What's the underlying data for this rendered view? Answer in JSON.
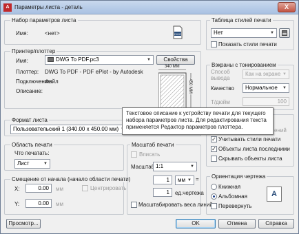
{
  "window": {
    "title": "Параметры листа - деталь",
    "app_icon": "autocad-icon",
    "close_glyph": "X"
  },
  "page_setup": {
    "group_label": "Набор параметров листа",
    "name_label": "Имя:",
    "name_value": "<нет>",
    "dwg_icon_text": "DWG"
  },
  "plotter": {
    "group_label": "Принтер/плоттер",
    "name_label": "Имя:",
    "device": "DWG To PDF.pc3",
    "properties_button": "Свойства",
    "plotter_label": "Плоттер:",
    "plotter_value": "DWG To PDF - PDF ePlot - by Autodesk",
    "connection_label": "Подключение:",
    "connection_value": "Файл",
    "description_label": "Описание:",
    "preview_width": "340 ММ",
    "preview_height": "450 ММ"
  },
  "tooltip": {
    "text": "Текстовое описание к устройству печати для текущего набора параметров листа. Для редактирования текста применяется Редактор параметров плоттера."
  },
  "paper_size": {
    "group_label": "Формат листа",
    "value": "Пользовательский 1 (340.00 x 450.00 мм)"
  },
  "plot_area": {
    "group_label": "Область печати",
    "what_label": "Что печатать:",
    "what_value": "Лист"
  },
  "plot_offset": {
    "group_label": "Смещение от начала (начало области печати)",
    "x_label": "X:",
    "x_value": "0.00",
    "x_unit": "мм",
    "y_label": "Y:",
    "y_value": "0.00",
    "y_unit": "мм",
    "center_label": "Центрировать"
  },
  "plot_scale": {
    "group_label": "Масштаб печати",
    "fit_label": "Вписать",
    "scale_label": "Масштаб:",
    "scale_value": "1:1",
    "value1": "1",
    "unit_value": "мм",
    "equals": "=",
    "value2": "1",
    "unit2_label": "ед.чертежа",
    "lineweights_label": "Масштабировать веса линий"
  },
  "plot_style": {
    "group_label": "Таблица стилей печати",
    "value": "Нет",
    "show_styles_label": "Показать стили печати"
  },
  "shaded": {
    "group_label": "Вэкраны с тонированием",
    "shade_label": "Способ вывода",
    "shade_value": "Как на экране",
    "quality_label": "Качество",
    "quality_value": "Нормальное",
    "dpi_label": "Т/дюйм",
    "dpi_value": "100"
  },
  "plot_options": {
    "partial_label": "ений",
    "lineweights_label": "Учитывать стили печати",
    "paperspace_last_label": "Объекты листа последними",
    "hide_label": "Скрывать объекты листа"
  },
  "orientation": {
    "group_label": "Ориентация чертежа",
    "portrait_label": "Книжная",
    "landscape_label": "Альбомная",
    "upside_down_label": "Перевернуть",
    "landscape_icon_letter": "A"
  },
  "footer": {
    "preview_button": "Просмотр...",
    "ok_button": "OK",
    "cancel_button": "Отмена",
    "help_button": "Справка"
  },
  "colors": {
    "accent": "#3c7fb1",
    "close_red": "#c35443",
    "title_bar": "#b9cde8"
  }
}
